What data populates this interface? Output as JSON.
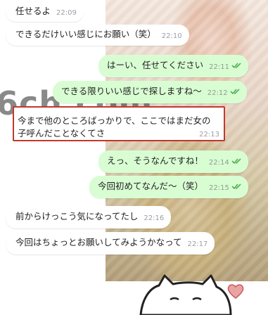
{
  "background": {
    "watermark": "6ch.com"
  },
  "messages": [
    {
      "dir": "in",
      "text": "任せるよ",
      "time": "22:09"
    },
    {
      "dir": "in",
      "text": "できるだけいい感じにお願い（笑）",
      "time": "22:10"
    },
    {
      "dir": "out",
      "text": "はーい、任せてください",
      "time": "22:11",
      "read": true
    },
    {
      "dir": "out",
      "text": "できる限りいい感じで探しますね〜",
      "time": "22:12",
      "read": true
    },
    {
      "dir": "in",
      "line1": "今まで他のところばっかりで、ここではまだ女の",
      "line2": "子呼んだことなくてさ",
      "time": "22:13",
      "highlighted": true
    },
    {
      "dir": "out",
      "text": "えっ、そうなんですね！",
      "time": "22:14",
      "read": true
    },
    {
      "dir": "out",
      "text": "今回初めてなんだ〜（笑）",
      "time": "22:15",
      "read": true
    },
    {
      "dir": "in",
      "text": "前からけっこう気になってたし",
      "time": "22:16"
    },
    {
      "dir": "in",
      "text": "今回はちょっとお願いしてみようかなって",
      "time": "22:17"
    }
  ],
  "colors": {
    "outgoing": "#d9fdd3",
    "incoming": "#ffffff",
    "read_check": "#4fae4f",
    "highlight_border": "#c0392b"
  }
}
